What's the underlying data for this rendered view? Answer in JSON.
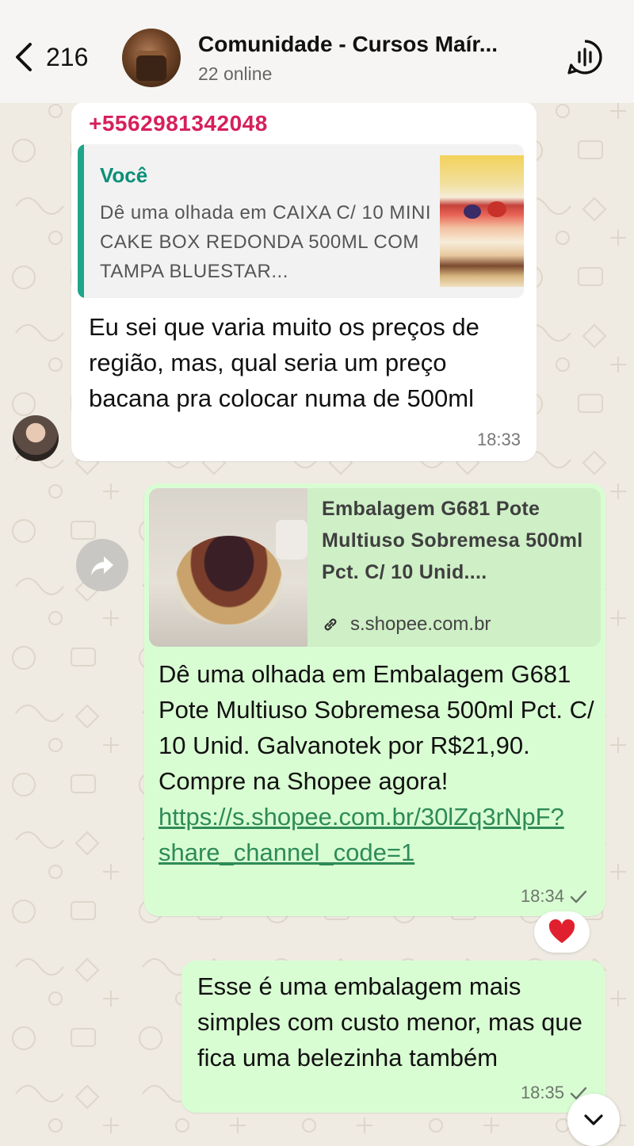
{
  "header": {
    "back_count": "216",
    "title": "Comunidade - Cursos Maír...",
    "subtitle": "22 online"
  },
  "messages": {
    "incoming": {
      "sender": "+5562981342048",
      "quote_author": "Você",
      "quote_text": "Dê uma olhada em CAIXA C/ 10 MINI CAKE BOX REDONDA 500ML COM TAMPA BLUESTAR...",
      "text": "Eu sei que varia muito os preços de região, mas, qual seria um preço bacana pra colocar numa de 500ml",
      "time": "18:33"
    },
    "outgoing_link": {
      "link_title": "Embalagem G681 Pote Multiuso Sobremesa 500ml Pct. C/ 10 Unid....",
      "link_domain": "s.shopee.com.br",
      "text": "Dê uma olhada em Embalagem G681 Pote Multiuso Sobremesa 500ml Pct. C/ 10 Unid. Galvanotek por R$21,90. Compre na Shopee agora! ",
      "url": "https://s.shopee.com.br/30lZq3rNpF?share_channel_code=1",
      "time": "18:34",
      "reaction": "heart"
    },
    "outgoing_text": {
      "text": "Esse é uma embalagem mais simples com custo menor, mas que fica uma belezinha também",
      "time": "18:35"
    }
  },
  "colors": {
    "outgoing_bubble": "#d9fdd3",
    "incoming_bubble": "#ffffff",
    "sender_name": "#d6205b",
    "quote_accent": "#1fa589",
    "link": "#2e8b57",
    "wallpaper": "#efeae2"
  },
  "icons": {
    "back": "chevron-left-icon",
    "call": "voice-chat-icon",
    "forward": "forward-arrow-icon",
    "link": "link-icon",
    "read": "check-icon",
    "reaction": "heart-icon",
    "scroll": "chevron-down-icon"
  }
}
